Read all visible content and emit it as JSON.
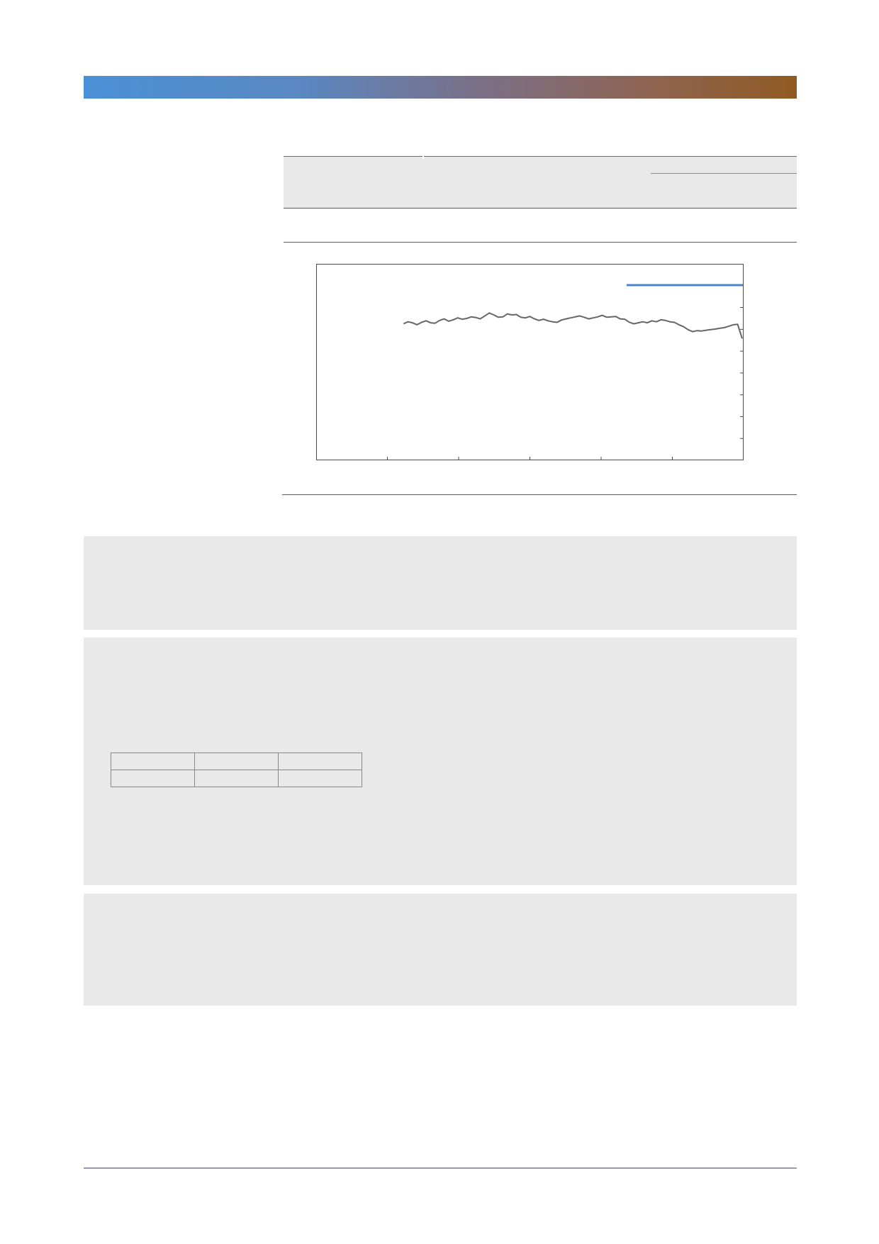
{
  "colors": {
    "header_gradient": [
      "#4a90d6",
      "#5a88c2",
      "#7a7088",
      "#8f6450",
      "#8f5a22"
    ],
    "panel_background": "#e9e9e9",
    "series_line": "#666666",
    "legend_line": "#4a86c8"
  },
  "summary_table": {
    "header_cells": [
      "",
      "",
      ""
    ],
    "rows": []
  },
  "chart_data": {
    "type": "line",
    "title": "",
    "xlabel": "",
    "ylabel": "",
    "x_ticks": 5,
    "y_ticks": 8,
    "grid": false,
    "legend": "top-right",
    "series": [
      {
        "color": "#666666",
        "x_start": 0.205,
        "x_end": 1.0,
        "values": [
          0.695,
          0.705,
          0.7,
          0.69,
          0.702,
          0.71,
          0.7,
          0.698,
          0.712,
          0.72,
          0.708,
          0.715,
          0.725,
          0.718,
          0.722,
          0.73,
          0.727,
          0.72,
          0.735,
          0.75,
          0.74,
          0.728,
          0.73,
          0.745,
          0.74,
          0.742,
          0.728,
          0.725,
          0.732,
          0.72,
          0.712,
          0.718,
          0.71,
          0.705,
          0.702,
          0.714,
          0.72,
          0.725,
          0.73,
          0.735,
          0.728,
          0.72,
          0.725,
          0.73,
          0.738,
          0.728,
          0.73,
          0.732,
          0.72,
          0.718,
          0.703,
          0.695,
          0.7,
          0.705,
          0.7,
          0.71,
          0.705,
          0.715,
          0.712,
          0.705,
          0.702,
          0.69,
          0.68,
          0.665,
          0.655,
          0.66,
          0.658,
          0.662,
          0.665,
          0.668,
          0.672,
          0.675,
          0.682,
          0.69,
          0.692,
          0.62
        ]
      }
    ]
  },
  "info_table": {
    "rows": [
      [
        "",
        "",
        ""
      ],
      [
        "",
        "",
        ""
      ]
    ]
  }
}
